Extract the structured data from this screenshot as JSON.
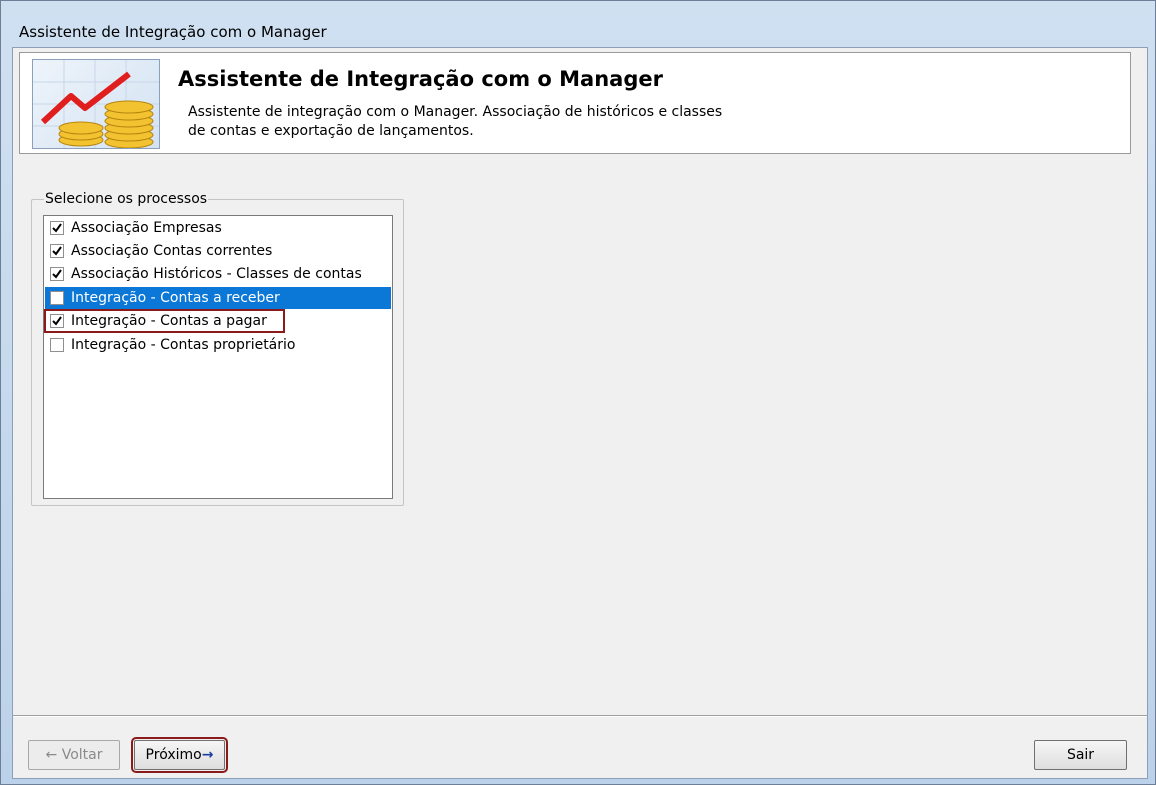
{
  "window": {
    "title": "Assistente de Integração com o Manager"
  },
  "header": {
    "title": "Assistente de Integração com o Manager",
    "description_line1": "Assistente de integração com o Manager. Associação de históricos e classes",
    "description_line2": "de contas e exportação de lançamentos."
  },
  "process_group": {
    "legend": "Selecione os processos",
    "items": [
      {
        "label": "Associação Empresas",
        "checked": true,
        "selected": false
      },
      {
        "label": "Associação Contas correntes",
        "checked": true,
        "selected": false
      },
      {
        "label": "Associação Históricos - Classes de contas",
        "checked": true,
        "selected": false
      },
      {
        "label": "Integração - Contas a receber",
        "checked": false,
        "selected": true
      },
      {
        "label": "Integração - Contas a pagar",
        "checked": true,
        "selected": false
      },
      {
        "label": "Integração - Contas proprietário",
        "checked": false,
        "selected": false
      }
    ]
  },
  "footer": {
    "back_label": "Voltar",
    "next_label": "Próximo",
    "exit_label": "Sair"
  },
  "colors": {
    "selection": "#0b78d7",
    "highlight_outline": "#8b1a1a"
  }
}
